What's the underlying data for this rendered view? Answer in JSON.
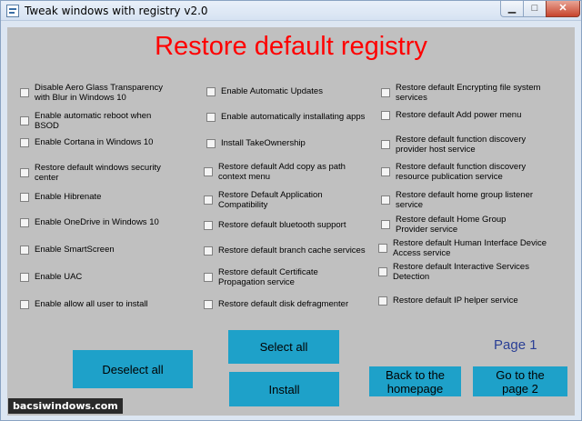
{
  "window": {
    "title": "Tweak windows with registry v2.0",
    "minimize_glyph": "▁",
    "maximize_glyph": "□",
    "close_glyph": "✕"
  },
  "main": {
    "heading": "Restore default registry",
    "columns": [
      [
        "Disable Aero Glass Transparency with Blur in Windows 10",
        "Enable automatic reboot when BSOD",
        "Enable Cortana in Windows 10",
        "Restore default windows security center",
        "Enable Hibrenate",
        "Enable OneDrive in Windows 10",
        "Enable SmartScreen",
        "Enable UAC",
        "Enable allow all user to install"
      ],
      [
        "Enable Automatic Updates",
        "Enable automatically installating apps",
        "Install TakeOwnership",
        "Restore default Add copy as path context menu",
        "Restore Default Application Compatibility",
        "Restore default bluetooth support",
        "Restore default branch cache services",
        "Restore default Certificate Propagation service",
        "Restore default disk defragmenter"
      ],
      [
        "Restore default Encrypting file system services",
        "Restore default Add power menu",
        "Restore default function discovery provider host service",
        "Restore default function discovery resource publication service",
        "Restore default home group listener service",
        "Restore default Home Group Provider service",
        "Restore default Human Interface Device Access service",
        "Restore default Interactive Services Detection",
        "Restore default IP helper service"
      ]
    ],
    "buttons": {
      "deselect_all": "Deselect all",
      "select_all": "Select all",
      "install": "Install",
      "back_home": "Back to the homepage",
      "next_page": "Go to the page 2"
    },
    "page_label": "Page 1"
  },
  "watermark": "bacsiwindows.com",
  "colors": {
    "heading": "#ff0000",
    "button": "#1ea1c9",
    "page_label": "#2a3f95",
    "client_background": "#c0c0c0"
  }
}
